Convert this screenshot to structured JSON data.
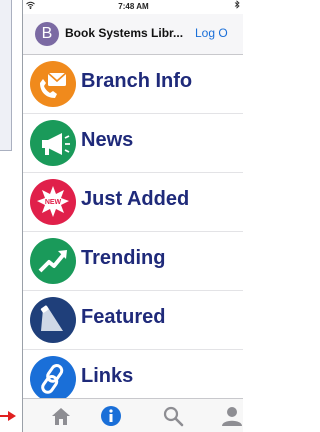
{
  "status_bar": {
    "time": "7:48 AM"
  },
  "nav": {
    "badge_letter": "B",
    "title": "Book Systems Libr...",
    "login_label": "Log O"
  },
  "menu": {
    "items": [
      {
        "label": "Branch Info",
        "icon": "envelope-phone-icon",
        "color": "#f08a1c"
      },
      {
        "label": "News",
        "icon": "megaphone-icon",
        "color": "#1a9a5a"
      },
      {
        "label": "Just Added",
        "icon": "new-burst-icon",
        "color": "#e0204a",
        "badge_text": "NEW"
      },
      {
        "label": "Trending",
        "icon": "trending-up-icon",
        "color": "#1a9a5a"
      },
      {
        "label": "Featured",
        "icon": "spotlight-icon",
        "color": "#1f3f7a"
      },
      {
        "label": "Links",
        "icon": "link-icon",
        "color": "#1a6fd8"
      }
    ]
  },
  "tabs": [
    {
      "icon": "home-icon",
      "active": false
    },
    {
      "icon": "info-icon",
      "active": true
    },
    {
      "icon": "search-icon",
      "active": false
    },
    {
      "icon": "account-icon",
      "active": false
    }
  ],
  "colors": {
    "label": "#1f2a7a",
    "tab_active": "#1a6fd8",
    "tab_inactive": "#8e8e93"
  }
}
